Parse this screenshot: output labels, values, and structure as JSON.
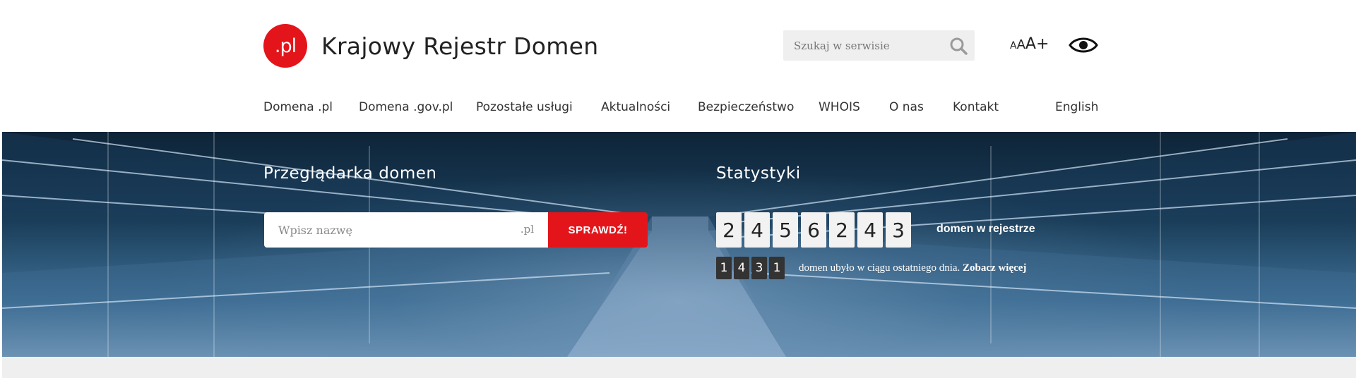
{
  "header": {
    "logo_badge": ".pl",
    "site_title": "Krajowy Rejestr Domen",
    "search_placeholder": "Szukaj w serwisie",
    "font_size_small": "A",
    "font_size_medium": "A",
    "font_size_large": "A+",
    "icons": [
      "search-icon",
      "eye-icon"
    ]
  },
  "nav": {
    "items": [
      "Domena .pl",
      "Domena .gov.pl",
      "Pozostałe usługi",
      "Aktualności",
      "Bezpieczeństwo",
      "WHOIS",
      "O nas",
      "Kontakt"
    ],
    "language": "English"
  },
  "domain_browser": {
    "title": "Przeglądarka domen",
    "input_placeholder": "Wpisz nazwę",
    "tld": ".pl",
    "button_label": "SPRAWDŹ!"
  },
  "statistics": {
    "title": "Statystyki",
    "total_digits": [
      "2",
      "4",
      "5",
      "6",
      "2",
      "4",
      "3"
    ],
    "total_label": "domen w rejestrze",
    "decrease_digits": [
      "1",
      "4",
      "3",
      "1"
    ],
    "decrease_label": "domen ubyło w ciągu ostatniego dnia.",
    "more_link": "Zobacz więcej"
  },
  "colors": {
    "brand_red": "#e3151b",
    "hero_dark": "#0e2438",
    "hero_light": "#8fb2d0"
  }
}
